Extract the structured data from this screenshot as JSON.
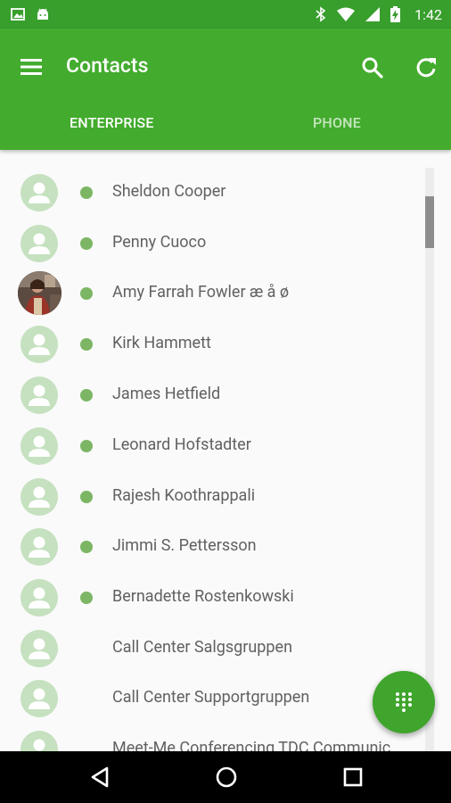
{
  "status_bar": {
    "time": "1:42",
    "icons": [
      "image-icon",
      "android-icon",
      "bluetooth-icon",
      "wifi-icon",
      "signal-icon",
      "battery-charging-icon"
    ]
  },
  "app_bar": {
    "title": "Contacts",
    "icons": [
      "menu-icon",
      "search-icon",
      "refresh-icon"
    ],
    "tabs": [
      {
        "label": "ENTERPRISE",
        "selected": true
      },
      {
        "label": "PHONE",
        "selected": false
      }
    ]
  },
  "contacts": [
    {
      "name": "Sheldon Cooper",
      "online": true,
      "photo": false
    },
    {
      "name": "Penny Cuoco",
      "online": true,
      "photo": false
    },
    {
      "name": "Amy Farrah Fowler æ å ø",
      "online": true,
      "photo": true
    },
    {
      "name": "Kirk Hammett",
      "online": true,
      "photo": false
    },
    {
      "name": "James Hetfield",
      "online": true,
      "photo": false
    },
    {
      "name": "Leonard Hofstadter",
      "online": true,
      "photo": false
    },
    {
      "name": "Rajesh Koothrappali",
      "online": true,
      "photo": false
    },
    {
      "name": "Jimmi S. Pettersson",
      "online": true,
      "photo": false
    },
    {
      "name": "Bernadette Rostenkowski",
      "online": true,
      "photo": false
    },
    {
      "name": "Call Center Salgsgruppen",
      "online": false,
      "photo": false
    },
    {
      "name": "Call Center Supportgruppen",
      "online": false,
      "photo": false
    },
    {
      "name": "Meet-Me Conferencing TDC Communic",
      "online": false,
      "photo": false
    }
  ],
  "fab": {
    "icon": "dialpad-icon"
  },
  "nav_bar": {
    "icons": [
      "back-icon",
      "home-icon",
      "recents-icon"
    ]
  },
  "colors": {
    "status_bar": "#389e2c",
    "app_bar": "#43ab2e",
    "avatar_placeholder": "#c5e1bf",
    "online_dot": "#7cb665",
    "fab": "#3fa52c"
  }
}
